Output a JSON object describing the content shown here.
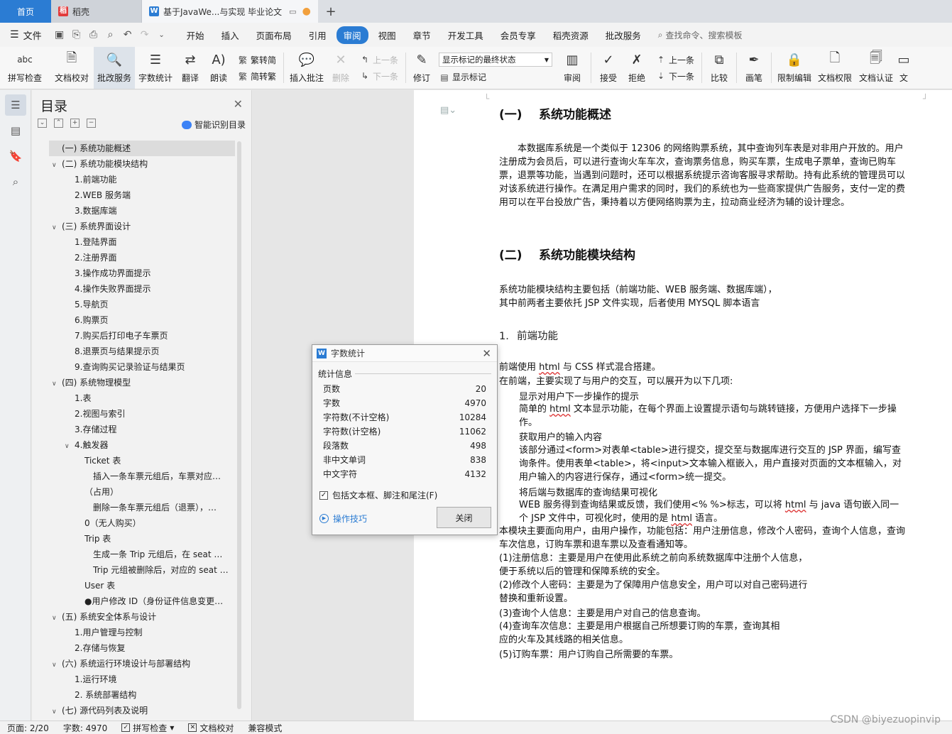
{
  "tabs": {
    "home": "首页",
    "daoke": "稻壳",
    "doc": "基于JavaWe...与实现 毕业论文"
  },
  "menu": {
    "file": "文件",
    "items": [
      "开始",
      "插入",
      "页面布局",
      "引用",
      "审阅",
      "视图",
      "章节",
      "开发工具",
      "会员专享",
      "稻壳资源",
      "批改服务"
    ],
    "active": "审阅",
    "search_placeholder": "查找命令、搜索模板"
  },
  "ribbon": {
    "spell": "拼写检查",
    "proofread": "文档校对",
    "correct": "批改服务",
    "wordcount": "字数统计",
    "translate": "翻译",
    "read": "朗读",
    "trad": "繁转简",
    "simp": "简转繁",
    "insert_comment": "插入批注",
    "delete": "删除",
    "prev_comment": "上一条",
    "next_comment": "下一条",
    "track": "修订",
    "markup_select": "显示标记的最终状态",
    "show_markup": "显示标记",
    "review": "审阅",
    "accept": "接受",
    "reject": "拒绝",
    "prev": "上一条",
    "next": "下一条",
    "compare": "比较",
    "pen": "画笔",
    "restrict": "限制编辑",
    "perm": "文档权限",
    "cert": "文档认证",
    "more": "文"
  },
  "toc": {
    "title": "目录",
    "smart": "智能识别目录",
    "items": [
      {
        "text": "(一) 系统功能概述",
        "level": 1,
        "caret": "",
        "selected": true
      },
      {
        "text": "(二) 系统功能模块结构",
        "level": 1,
        "caret": "v"
      },
      {
        "text": "1.前端功能",
        "level": 2,
        "caret": ""
      },
      {
        "text": "2.WEB 服务端",
        "level": 2,
        "caret": ""
      },
      {
        "text": "3.数据库端",
        "level": 2,
        "caret": ""
      },
      {
        "text": "(三) 系统界面设计",
        "level": 1,
        "caret": "v"
      },
      {
        "text": "1.登陆界面",
        "level": 2,
        "caret": ""
      },
      {
        "text": "2.注册界面",
        "level": 2,
        "caret": ""
      },
      {
        "text": "3.操作成功界面提示",
        "level": 2,
        "caret": ""
      },
      {
        "text": "4.操作失败界面提示",
        "level": 2,
        "caret": ""
      },
      {
        "text": "5.导航页",
        "level": 2,
        "caret": ""
      },
      {
        "text": "6.购票页",
        "level": 2,
        "caret": ""
      },
      {
        "text": "7.购买后打印电子车票页",
        "level": 2,
        "caret": ""
      },
      {
        "text": "8.退票页与结果提示页",
        "level": 2,
        "caret": ""
      },
      {
        "text": "9.查询购买记录验证与结果页",
        "level": 2,
        "caret": ""
      },
      {
        "text": "(四) 系统物理模型",
        "level": 1,
        "caret": "v"
      },
      {
        "text": "1.表",
        "level": 2,
        "caret": ""
      },
      {
        "text": "2.视图与索引",
        "level": 2,
        "caret": ""
      },
      {
        "text": "3.存储过程",
        "level": 2,
        "caret": ""
      },
      {
        "text": "4.触发器",
        "level": 2,
        "caret": "v"
      },
      {
        "text": "Ticket 表",
        "level": 3,
        "caret": ""
      },
      {
        "text": "插入一条车票元组后，车票对应…",
        "level": 4,
        "caret": ""
      },
      {
        "text": "（占用）",
        "level": 3,
        "caret": ""
      },
      {
        "text": "删除一条车票元组后（退票），…",
        "level": 4,
        "caret": ""
      },
      {
        "text": "0（无人购买）",
        "level": 3,
        "caret": ""
      },
      {
        "text": "Trip 表",
        "level": 3,
        "caret": ""
      },
      {
        "text": "生成一条 Trip 元组后，在 seat …",
        "level": 4,
        "caret": ""
      },
      {
        "text": "Trip 元组被删除后，对应的 seat …",
        "level": 4,
        "caret": ""
      },
      {
        "text": "User 表",
        "level": 3,
        "caret": ""
      },
      {
        "text": "●用户修改 ID（身份证件信息变更…",
        "level": 3,
        "caret": ""
      },
      {
        "text": "(五) 系统安全体系与设计",
        "level": 1,
        "caret": "v"
      },
      {
        "text": "1.用户管理与控制",
        "level": 2,
        "caret": ""
      },
      {
        "text": "2.存储与恢复",
        "level": 2,
        "caret": ""
      },
      {
        "text": "(六) 系统运行环境设计与部署结构",
        "level": 1,
        "caret": "v"
      },
      {
        "text": "1.运行环境",
        "level": 2,
        "caret": ""
      },
      {
        "text": "2. 系统部署结构",
        "level": 2,
        "caret": ""
      },
      {
        "text": "(七) 源代码列表及说明",
        "level": 1,
        "caret": "v"
      }
    ]
  },
  "doc": {
    "h1a_num": "(一)",
    "h1a_text": "系统功能概述",
    "p1": "本数据库系统是一个类似于 12306 的网络购票系统，其中查询列车表是对非用户开放的。用户注册成为会员后，可以进行查询火车车次，查询票务信息，购买车票，生成电子票单，查询已购车票，退票等功能，当遇到问题时，还可以根据系统提示咨询客服寻求帮助。持有此系统的管理员可以对该系统进行操作。在满足用户需求的同时，我们的系统也为一些商家提供广告服务，支付一定的费用可以在平台投放广告，秉持着以方便网络购票为主，拉动商业经济为辅的设计理念。",
    "h1b_num": "(二)",
    "h1b_text": "系统功能模块结构",
    "p2a": "系统功能模块结构主要包括（前端功能、WEB 服务端、数据库端），",
    "p2b": "其中前两者主要依托 JSP 文件实现，后者使用 MYSQL 脚本语言",
    "h2_num": "1.",
    "h2_text": "前端功能",
    "p3a_pre": "前端使用 ",
    "p3a_u": "html",
    "p3a_post": " 与 CSS 样式混合搭建。",
    "p3b": "在前端，主要实现了与用户的交互，可以展开为以下几项:",
    "s1_title": "显示对用户下一步操作的提示",
    "s1_pre": "简单的 ",
    "s1_u": "html",
    "s1_post": " 文本显示功能，在每个界面上设置提示语句与跳转链接，方便用户选择下一步操作。",
    "s2_title": "获取用户的输入内容",
    "s2_body": "该部分通过<form>对表单<table>进行提交，提交至与数据库进行交互的 JSP 界面，编写查询条件。使用表单<table>，将<input>文本输入框嵌入，用户直接对页面的文本框输入，对用户输入的内容进行保存，通过<form>统一提交。",
    "s3_title": "将后端与数据库的查询结果可视化",
    "s3_pre": "WEB 服务得到查询结果或反馈，我们使用<% %>标志，可以将 ",
    "s3_u1": "html",
    "s3_mid": " 与 java 语句嵌入同一个 JSP 文件中，可视化时，使用的是 ",
    "s3_u2": "html",
    "s3_post": " 语言。",
    "p4": "本模块主要面向用户，由用户操作，功能包括：用户注册信息，修改个人密码，查询个人信息，查询车次信息，订购车票和退车票以及查看通知等。",
    "l1a": "(1)注册信息：主要是用户在使用此系统之前向系统数据库中注册个人信息，",
    "l1b": "便于系统以后的管理和保障系统的安全。",
    "l2a": "(2)修改个人密码：主要是为了保障用户信息安全，用户可以对自己密码进行",
    "l2b": "替换和重新设置。",
    "l3": "(3)查询个人信息：主要是用户对自己的信息查询。",
    "l4a": "(4)查询车次信息：主要是用户根据自己所想要订购的车票，查询其相",
    "l4b": "应的火车及其线路的相关信息。",
    "l5": "(5)订购车票：用户订购自己所需要的车票。"
  },
  "dialog": {
    "title": "字数统计",
    "section": "统计信息",
    "rows": [
      {
        "label": "页数",
        "value": "20"
      },
      {
        "label": "字数",
        "value": "4970"
      },
      {
        "label": "字符数(不计空格)",
        "value": "10284"
      },
      {
        "label": "字符数(计空格)",
        "value": "11062"
      },
      {
        "label": "段落数",
        "value": "498"
      },
      {
        "label": "非中文单词",
        "value": "838"
      },
      {
        "label": "中文字符",
        "value": "4132"
      }
    ],
    "checkbox": "包括文本框、脚注和尾注(F)",
    "tips": "操作技巧",
    "close": "关闭"
  },
  "status": {
    "page": "页面: 2/20",
    "words": "字数: 4970",
    "spell": "拼写检查",
    "proof": "文档校对",
    "compat": "兼容模式"
  },
  "watermark": "CSDN @biyezuopinvip",
  "colors": {
    "accent": "#2b7cd3",
    "active_tab": "#2b7cd3"
  }
}
